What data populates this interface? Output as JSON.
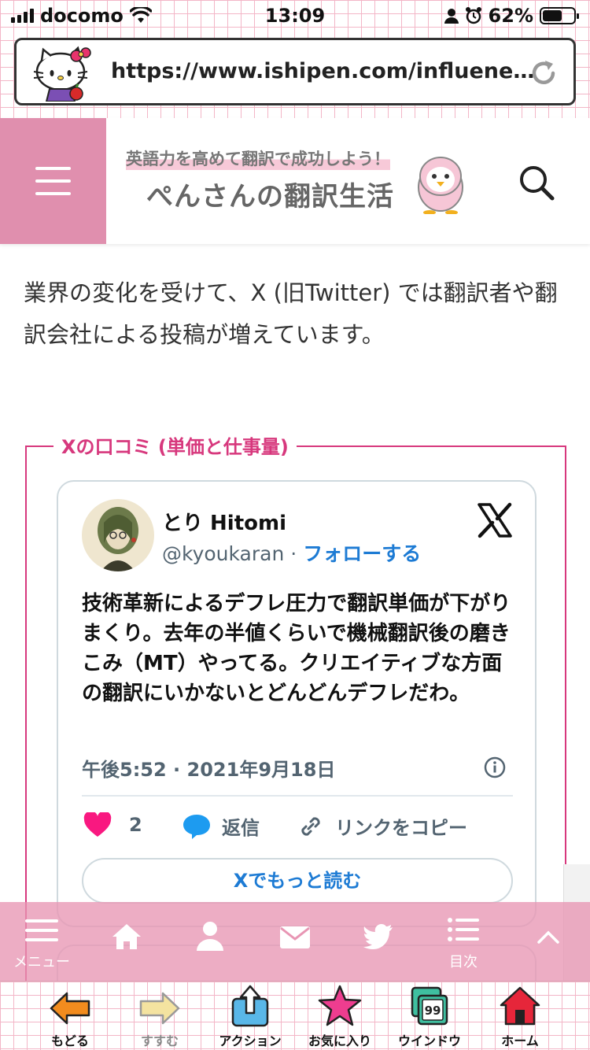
{
  "status": {
    "carrier": "docomo",
    "time": "13:09",
    "battery": "62%",
    "battery_level": 0.62
  },
  "browser": {
    "url": "https://www.ishipen.com/influenece-..."
  },
  "site": {
    "logo_tagline": "英語力を高めて翻訳で成功しよう！",
    "logo_title": "ぺんさんの翻訳生活"
  },
  "article": {
    "lead": "業界の変化を受けて、X (旧Twitter) では翻訳者や翻訳会社による投稿が増えています。",
    "box_label": "Xの口コミ (単価と仕事量)"
  },
  "tweet": {
    "name": "とり Hitomi",
    "handle": "@kyoukaran",
    "dot": "·",
    "follow": "フォローする",
    "text": "技術革新によるデフレ圧力で翻訳単価が下がりまくり。去年の半値くらいで機械翻訳後の磨きこみ（MT）やってる。クリエイティブな方面の翻訳にいかないとどんどんデフレだわ。",
    "date": "午後5:52 · 2021年9月18日",
    "likes": "2",
    "reply": "返信",
    "copy_link": "リンクをコピー",
    "read_more": "Xでもっと読む"
  },
  "site_nav": {
    "menu": "メニュー",
    "toc": "目次"
  },
  "toolbar": {
    "back": "もどる",
    "forward": "すすむ",
    "action": "アクション",
    "favorites": "お気に入り",
    "windows": "ウインドウ",
    "windows_count": "99",
    "home": "ホーム"
  },
  "colors": {
    "accent_pink": "#e08fae",
    "box_border": "#d7387d",
    "link_blue": "#1d7bd4",
    "like_pink": "#f91880"
  }
}
